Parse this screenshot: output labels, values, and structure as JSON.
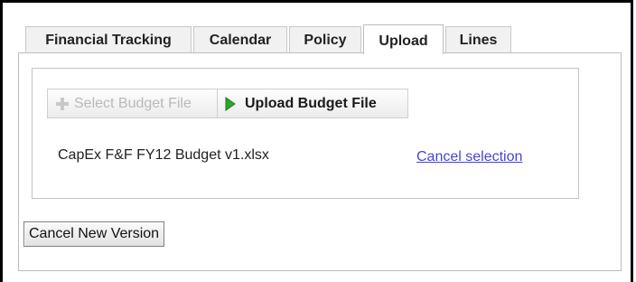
{
  "tabs": [
    {
      "label": "Financial Tracking"
    },
    {
      "label": "Calendar"
    },
    {
      "label": "Policy"
    },
    {
      "label": "Upload",
      "active": true
    },
    {
      "label": "Lines"
    }
  ],
  "upload": {
    "select_button_label": "Select Budget File",
    "select_button_icon": "plus-icon",
    "upload_button_label": "Upload Budget File",
    "upload_button_icon": "play-arrow-icon",
    "selected_file_name": "CapEx F&F FY12 Budget v1.xlsx",
    "cancel_selection_label": "Cancel selection"
  },
  "footer": {
    "cancel_new_version_label": "Cancel New Version"
  },
  "colors": {
    "link": "#4646c8",
    "upload_arrow": "#2fa52f",
    "disabled_text": "#b9b9b9"
  }
}
